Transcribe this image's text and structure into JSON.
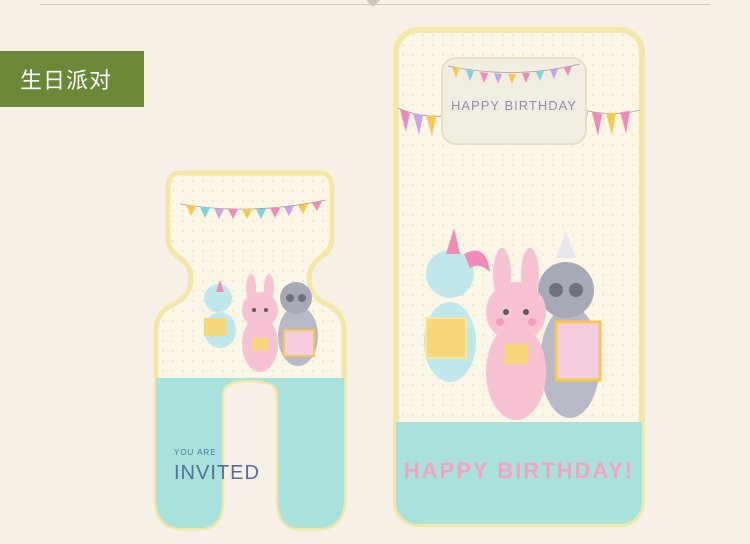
{
  "category_label": "生日派对",
  "small_mat": {
    "text_line1": "YOU ARE",
    "text_line2": "INVITED"
  },
  "large_mat": {
    "pillow_text": "HAPPY BIRTHDAY",
    "banner_text": "HAPPY BIRTHDAY!"
  },
  "colors": {
    "tag_green": "#6b8738",
    "mat_cream": "#fbf6e5",
    "mat_aqua": "#a9e2dc",
    "piping_yellow": "#f3e7a6",
    "bunting": [
      "#f08bb8",
      "#7dd3e0",
      "#f6c94e",
      "#c9a4e6"
    ]
  }
}
